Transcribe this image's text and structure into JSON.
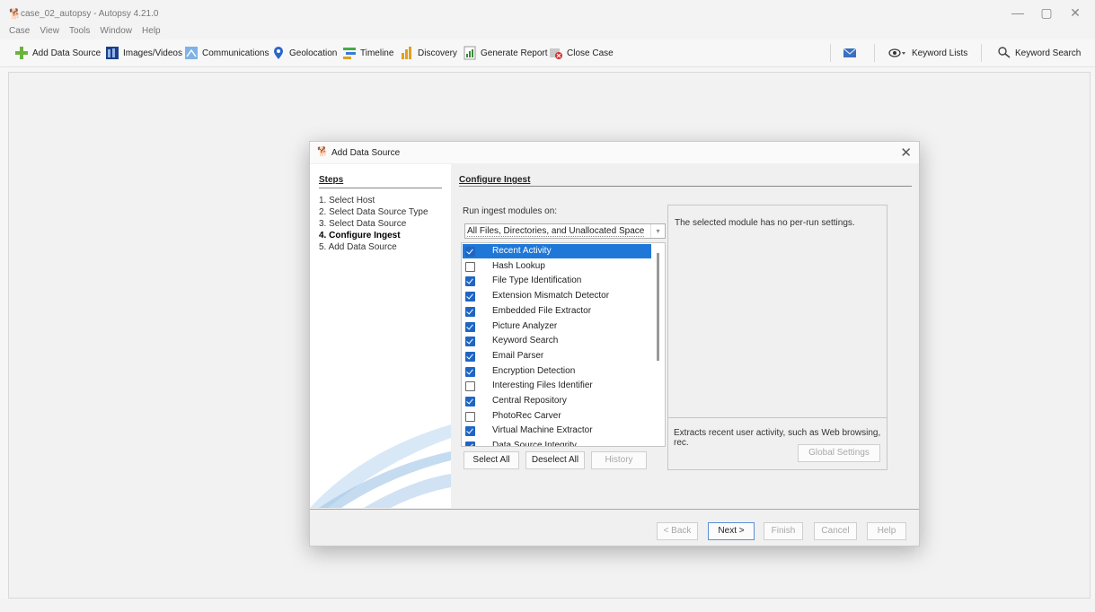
{
  "window": {
    "title": "case_02_autopsy - Autopsy 4.21.0",
    "minimize": "—",
    "maximize": "▢",
    "close": "✕"
  },
  "menu": [
    "Case",
    "View",
    "Tools",
    "Window",
    "Help"
  ],
  "toolbar": {
    "add_data_source": "Add Data Source",
    "images_videos": "Images/Videos",
    "communications": "Communications",
    "geolocation": "Geolocation",
    "timeline": "Timeline",
    "discovery": "Discovery",
    "generate_report": "Generate Report",
    "close_case": "Close Case",
    "keyword_lists": "Keyword Lists",
    "keyword_search": "Keyword Search"
  },
  "dialog": {
    "title": "Add Data Source",
    "steps_heading": "Steps",
    "steps": [
      "1.   Select Host",
      "2.   Select Data Source Type",
      "3.   Select Data Source",
      "4.   Configure Ingest",
      "5.   Add Data Source"
    ],
    "current_step": 3,
    "section_title": "Configure Ingest",
    "run_on_label": "Run ingest modules on:",
    "run_on_value": "All Files, Directories, and Unallocated Space",
    "modules": [
      {
        "name": "Recent Activity",
        "checked": true,
        "selected": true
      },
      {
        "name": "Hash Lookup",
        "checked": false,
        "selected": false
      },
      {
        "name": "File Type Identification",
        "checked": true,
        "selected": false
      },
      {
        "name": "Extension Mismatch Detector",
        "checked": true,
        "selected": false
      },
      {
        "name": "Embedded File Extractor",
        "checked": true,
        "selected": false
      },
      {
        "name": "Picture Analyzer",
        "checked": true,
        "selected": false
      },
      {
        "name": "Keyword Search",
        "checked": true,
        "selected": false
      },
      {
        "name": "Email Parser",
        "checked": true,
        "selected": false
      },
      {
        "name": "Encryption Detection",
        "checked": true,
        "selected": false
      },
      {
        "name": "Interesting Files Identifier",
        "checked": false,
        "selected": false
      },
      {
        "name": "Central Repository",
        "checked": true,
        "selected": false
      },
      {
        "name": "PhotoRec Carver",
        "checked": false,
        "selected": false
      },
      {
        "name": "Virtual Machine Extractor",
        "checked": true,
        "selected": false
      },
      {
        "name": "Data Source Integrity",
        "checked": true,
        "selected": false
      }
    ],
    "select_all": "Select All",
    "deselect_all": "Deselect All",
    "history": "History",
    "settings_text": "The selected module has no per-run settings.",
    "module_description": "Extracts recent user activity, such as Web browsing, rec.",
    "global_settings": "Global Settings",
    "buttons": {
      "back": "< Back",
      "next": "Next >",
      "finish": "Finish",
      "cancel": "Cancel",
      "help": "Help"
    }
  },
  "colors": {
    "selection": "#1f78d8",
    "checkbox": "#1f66c4"
  }
}
